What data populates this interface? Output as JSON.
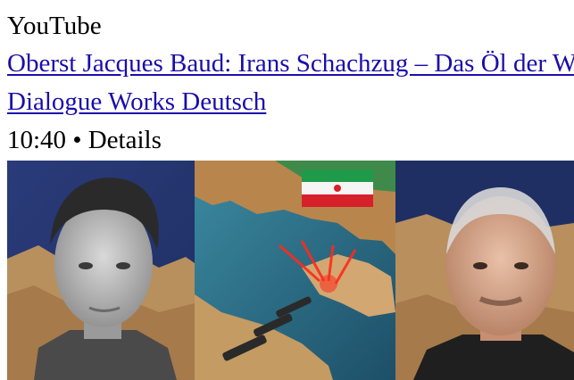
{
  "source": "YouTube",
  "video": {
    "title": "Oberst Jacques Baud: Irans Schachzug – Das Öl der Welt",
    "channel": "Dialogue Works Deutsch",
    "duration": "10:40",
    "separator": "•",
    "details_label": "Details"
  },
  "thumbnail": {
    "colors": {
      "left_background": "#2a3b7a",
      "map_water": "#2f6f86",
      "land": "#c99a5c",
      "missile": "#ff2a1a",
      "right_background": "#1f2f63"
    },
    "flag": "Iran flag",
    "left_person": "young man portrait (grayscale)",
    "right_person": "older bald man with mustache"
  }
}
